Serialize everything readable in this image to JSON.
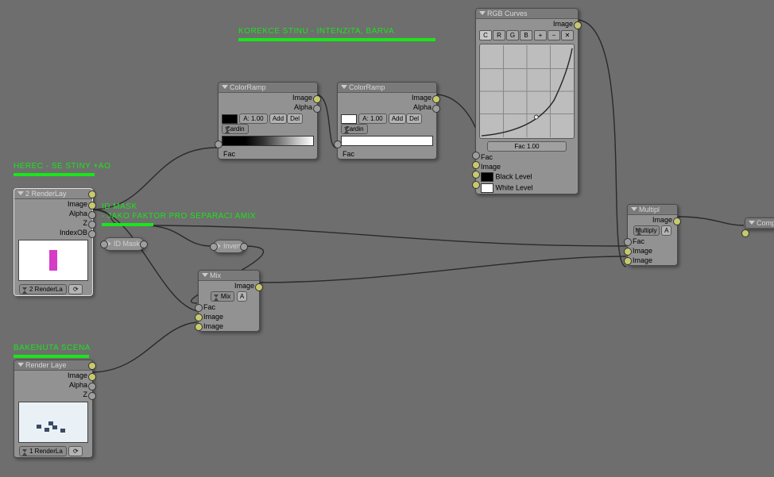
{
  "labels": {
    "image": "Image",
    "alpha": "Alpha",
    "z": "Z",
    "indexob": "IndexOB",
    "fac": "Fac",
    "black": "Black Level",
    "white": "White Level"
  },
  "annotations": {
    "korekce": "KOREKCE STINU - INTENZITA, BARVA",
    "herec": "HEREC - SE STINY +AO",
    "idmask1": "ID MASK",
    "idmask2": "- JAKO FAKTOR PRO SEPARACI AMIX",
    "baked": "BAKENUTA SCENA"
  },
  "nodes": {
    "rl2": {
      "title": "2 RenderLay",
      "layer": "2 RenderLa"
    },
    "rl1": {
      "title": "Render Laye",
      "layer": "1 RenderLa"
    },
    "idmask": {
      "title": "ID Mask"
    },
    "invert": {
      "title": "Invert"
    },
    "cr1": {
      "title": "ColorRamp",
      "a": "A: 1.00",
      "add": "Add",
      "del": "Del",
      "interp": "Cardin"
    },
    "cr2": {
      "title": "ColorRamp",
      "a": "A: 1.00",
      "add": "Add",
      "del": "Del",
      "interp": "Cardin"
    },
    "mix": {
      "title": "Mix",
      "mode": "Mix",
      "a": "A"
    },
    "rgb": {
      "title": "RGB Curves",
      "c": "C",
      "r": "R",
      "g": "G",
      "b": "B",
      "fac": "Fac 1.00"
    },
    "mult": {
      "title": "Multipl",
      "mode": "Multiply",
      "a": "A"
    },
    "comp": {
      "title": "Compo:"
    }
  }
}
